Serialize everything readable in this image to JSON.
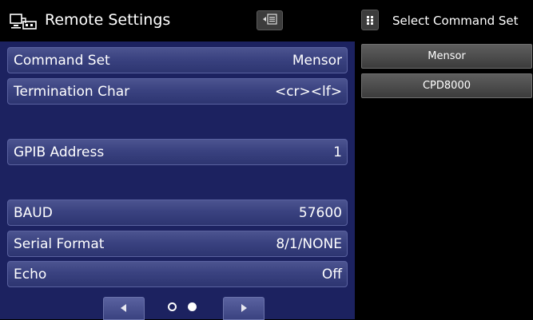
{
  "header": {
    "title": "Remote Settings"
  },
  "rows": [
    {
      "label": "Command Set",
      "value": "Mensor"
    },
    {
      "label": "Termination Char",
      "value": "<cr><lf>"
    },
    {
      "label": "GPIB Address",
      "value": "1"
    },
    {
      "label": "BAUD",
      "value": "57600"
    },
    {
      "label": "Serial Format",
      "value": "8/1/NONE"
    },
    {
      "label": "Echo",
      "value": "Off"
    }
  ],
  "pager": {
    "page": 2,
    "total": 2
  },
  "selector": {
    "title": "Select Command Set",
    "options": [
      "Mensor",
      "CPD8000"
    ]
  }
}
